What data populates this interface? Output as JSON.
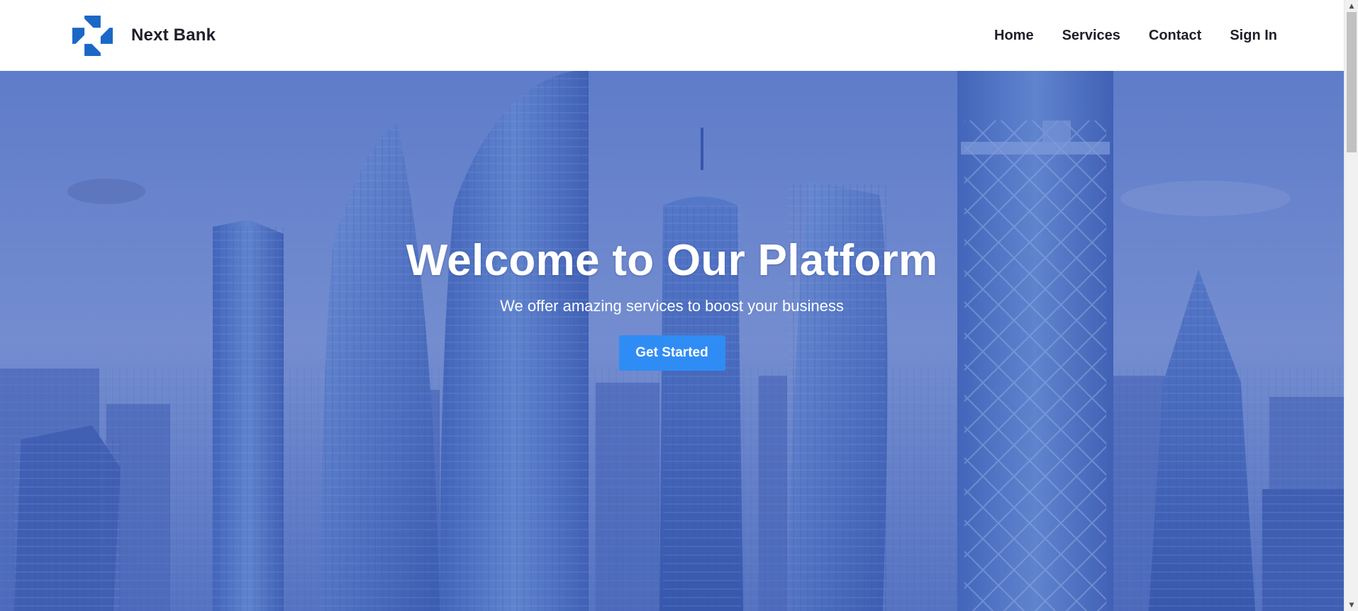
{
  "header": {
    "brand_name": "Next Bank",
    "logo_icon": "octagon-logo-icon",
    "nav": [
      {
        "label": "Home"
      },
      {
        "label": "Services"
      },
      {
        "label": "Contact"
      },
      {
        "label": "Sign In"
      }
    ]
  },
  "hero": {
    "title": "Welcome to Our Platform",
    "subtitle": "We offer amazing services to boost your business",
    "cta_label": "Get Started",
    "background": "city-skyline-image"
  },
  "colors": {
    "brand_blue": "#1b67c6",
    "cta_blue": "#2f8cf5",
    "text_dark": "#1f1f2b",
    "hero_tint": "#4f6dbd"
  },
  "scrollbar": {
    "up_icon": "arrow-up-icon",
    "down_icon": "arrow-down-icon"
  }
}
